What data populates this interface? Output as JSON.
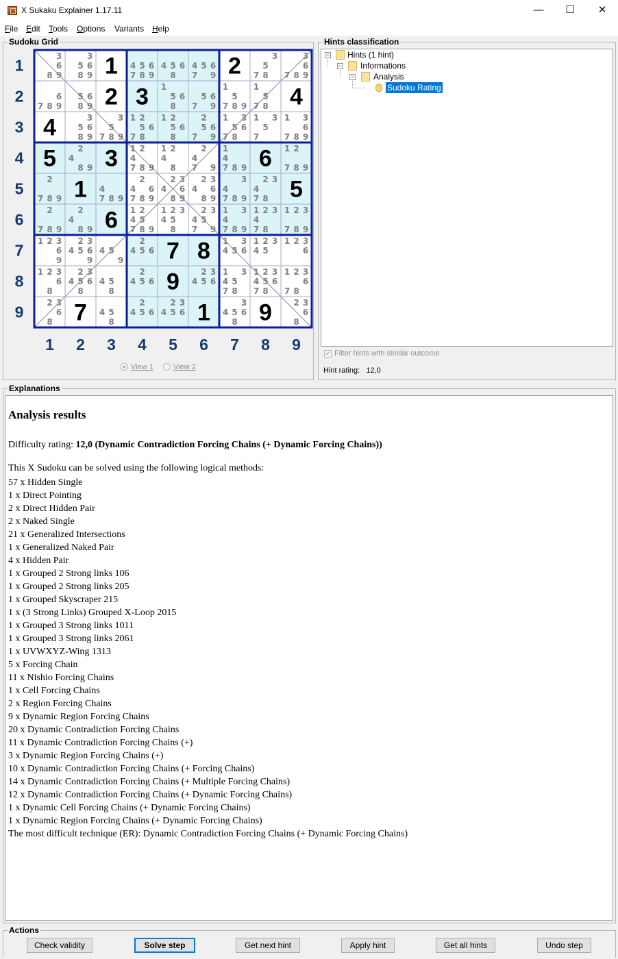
{
  "window": {
    "title": "X Sukaku Explainer 1.17.11",
    "minimize": "—",
    "maximize": "☐",
    "close": "✕"
  },
  "menu": [
    {
      "label": "File",
      "accel": "F",
      "rest": "ile"
    },
    {
      "label": "Edit",
      "accel": "E",
      "rest": "dit"
    },
    {
      "label": "Tools",
      "accel": "T",
      "rest": "ools"
    },
    {
      "label": "Options",
      "accel": "O",
      "rest": "ptions"
    },
    {
      "label": "Variants",
      "accel": "",
      "rest": "Variants"
    },
    {
      "label": "Help",
      "accel": "H",
      "rest": "elp"
    }
  ],
  "grid_panel": {
    "title": "Sudoku Grid",
    "row_labels": [
      "1",
      "2",
      "3",
      "4",
      "5",
      "6",
      "7",
      "8",
      "9"
    ],
    "col_labels": [
      "1",
      "2",
      "3",
      "4",
      "5",
      "6",
      "7",
      "8",
      "9"
    ],
    "view1": "View 1",
    "view2": "View 2"
  },
  "grid": {
    "cells": [
      [
        {
          "c": "3689"
        },
        {
          "c": "35689"
        },
        {
          "v": "1"
        },
        {
          "c": "456789"
        },
        {
          "c": "4568"
        },
        {
          "c": "45679"
        },
        {
          "v": "2"
        },
        {
          "c": "3578"
        },
        {
          "c": "36789"
        }
      ],
      [
        {
          "c": "6789"
        },
        {
          "c": "5689"
        },
        {
          "v": "2"
        },
        {
          "v": "3"
        },
        {
          "c": "1568"
        },
        {
          "c": "5679"
        },
        {
          "c": "15789"
        },
        {
          "c": "1578"
        },
        {
          "v": "4"
        }
      ],
      [
        {
          "v": "4"
        },
        {
          "c": "35689"
        },
        {
          "c": "35789"
        },
        {
          "c": "125678"
        },
        {
          "c": "12568"
        },
        {
          "c": "25679"
        },
        {
          "c": "135678"
        },
        {
          "c": "1357"
        },
        {
          "c": "136789"
        }
      ],
      [
        {
          "v": "5"
        },
        {
          "c": "2489"
        },
        {
          "v": "3"
        },
        {
          "c": "124789"
        },
        {
          "c": "1248"
        },
        {
          "c": "2479"
        },
        {
          "c": "14789"
        },
        {
          "v": "6"
        },
        {
          "c": "12789"
        }
      ],
      [
        {
          "c": "2789"
        },
        {
          "v": "1"
        },
        {
          "c": "4789"
        },
        {
          "c": "246789"
        },
        {
          "c": "234689"
        },
        {
          "c": "234689"
        },
        {
          "c": "34789"
        },
        {
          "c": "23478"
        },
        {
          "v": "5"
        }
      ],
      [
        {
          "c": "2789"
        },
        {
          "c": "2489"
        },
        {
          "v": "6"
        },
        {
          "c": "1245789"
        },
        {
          "c": "123458"
        },
        {
          "c": "234579"
        },
        {
          "c": "134789"
        },
        {
          "c": "123478"
        },
        {
          "c": "123789"
        }
      ],
      [
        {
          "c": "12369"
        },
        {
          "c": "234569"
        },
        {
          "c": "459"
        },
        {
          "c": "2456"
        },
        {
          "v": "7"
        },
        {
          "v": "8"
        },
        {
          "c": "13456"
        },
        {
          "c": "12345"
        },
        {
          "c": "1236"
        }
      ],
      [
        {
          "c": "12368"
        },
        {
          "c": "234568"
        },
        {
          "c": "458"
        },
        {
          "c": "2456"
        },
        {
          "v": "9"
        },
        {
          "c": "23456"
        },
        {
          "c": "134578"
        },
        {
          "c": "12345678"
        },
        {
          "c": "123678"
        }
      ],
      [
        {
          "c": "2368"
        },
        {
          "v": "7"
        },
        {
          "c": "458"
        },
        {
          "c": "2456"
        },
        {
          "c": "23456"
        },
        {
          "v": "1"
        },
        {
          "c": "34568"
        },
        {
          "v": "9"
        },
        {
          "c": "2368"
        }
      ]
    ]
  },
  "colors": {
    "box_border": "#0b1e9c",
    "cell_border": "#a7a7d2",
    "shade": "#dbf4f8",
    "diagonal": "#8a8a8a",
    "selection": "#0078d7"
  },
  "hints_panel": {
    "title": "Hints classification",
    "tree": {
      "root": "Hints (1 hint)",
      "child": "Informations",
      "grandchild": "Analysis",
      "leaf": "Sudoku Rating",
      "expander": "−"
    },
    "leaf_icon": "lightbulb-icon",
    "filter_label": "Filter hints with similar outcome",
    "filter_mark": "✓",
    "rating_label": "Hint rating:",
    "rating_value": "12,0"
  },
  "explanations": {
    "title": "Explanations",
    "heading": "Analysis results",
    "difficulty_prefix": "Difficulty rating: ",
    "difficulty_value": "12,0 (Dynamic Contradiction Forcing Chains (+ Dynamic Forcing Chains))",
    "intro": "This X Sudoku can be solved using the following logical methods:",
    "methods": [
      "57 x Hidden Single",
      "1 x Direct Pointing",
      "2 x Direct Hidden Pair",
      "2 x Naked Single",
      "21 x Generalized Intersections",
      "1 x Generalized Naked Pair",
      "4 x Hidden Pair",
      "1 x Grouped 2 Strong links 106",
      "1 x Grouped 2 Strong links 205",
      "1 x Grouped Skyscraper 215",
      "1 x (3 Strong Links) Grouped X-Loop 2015",
      "1 x Grouped 3 Strong links 1011",
      "1 x Grouped 3 Strong links 2061",
      "1 x UVWXYZ-Wing 1313",
      "5 x Forcing Chain",
      "11 x Nishio Forcing Chains",
      "1 x Cell Forcing Chains",
      "2 x Region Forcing Chains",
      "9 x Dynamic Region Forcing Chains",
      "20 x Dynamic Contradiction Forcing Chains",
      "11 x Dynamic Contradiction Forcing Chains (+)",
      "3 x Dynamic Region Forcing Chains (+)",
      "10 x Dynamic Contradiction Forcing Chains (+ Forcing Chains)",
      "14 x Dynamic Contradiction Forcing Chains (+ Multiple Forcing Chains)",
      "12 x Dynamic Contradiction Forcing Chains (+ Dynamic Forcing Chains)",
      "1 x Dynamic Cell Forcing Chains (+ Dynamic Forcing Chains)",
      "1 x Dynamic Region Forcing Chains (+ Dynamic Forcing Chains)",
      "The most difficult technique (ER): Dynamic Contradiction Forcing Chains (+ Dynamic Forcing Chains)"
    ]
  },
  "actions": {
    "title": "Actions",
    "buttons": [
      {
        "label": "Check validity",
        "name": "check-validity-button"
      },
      {
        "label": "Solve step",
        "name": "solve-step-button"
      },
      {
        "label": "Get next hint",
        "name": "get-next-hint-button"
      },
      {
        "label": "Apply hint",
        "name": "apply-hint-button"
      },
      {
        "label": "Get all hints",
        "name": "get-all-hints-button"
      },
      {
        "label": "Undo step",
        "name": "undo-step-button"
      }
    ]
  }
}
